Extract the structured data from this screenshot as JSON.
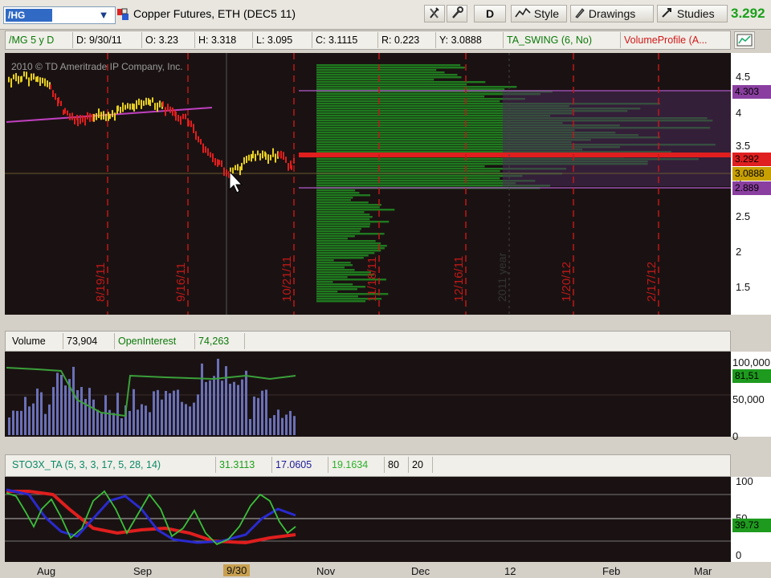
{
  "toolbar": {
    "symbol": "/HG",
    "title": "Copper Futures, ETH (DEC5 11)",
    "period_label": "D",
    "style_label": "Style",
    "drawings_label": "Drawings",
    "studies_label": "Studies",
    "last_price": "3.292"
  },
  "info_bar": {
    "symbol_period": "/MG 5 y D",
    "date": "D: 9/30/11",
    "open": "O: 3.23",
    "high": "H: 3.318",
    "low": "L: 3.095",
    "close": "C: 3.1115",
    "range": "R: 0.223",
    "y": "Y: 3.0888",
    "study1": "TA_SWING (6, No)",
    "study2": "VolumeProfile (A..."
  },
  "price_panel": {
    "copyright": "2010 © TD Ameritrade IP Company, Inc.",
    "axis_ticks": [
      "4.5",
      "4",
      "3.5",
      "3",
      "2.5",
      "2",
      "1.5"
    ],
    "badges": [
      {
        "text": "4.303",
        "color": "#8a3fa0"
      },
      {
        "text": "3.292",
        "color": "#e02020"
      },
      {
        "text": "3.0888",
        "color": "#c8a000"
      },
      {
        "text": "2.889",
        "color": "#8a3fa0"
      }
    ],
    "date_labels": [
      "8/19/11",
      "9/16/11",
      "10/21/11",
      "11/18/11",
      "12/16/11",
      "1/20/12",
      "2/17/12"
    ],
    "year_label": "2011 year"
  },
  "volume_panel": {
    "label": "Volume",
    "volume_value": "73,904",
    "oi_label": "OpenInterest",
    "oi_value": "74,263",
    "axis_ticks": [
      "100,000",
      "50,000",
      "0"
    ],
    "badge": "81,51"
  },
  "sto_panel": {
    "label": "STO3X_TA (5, 3, 3, 17, 5, 28, 14)",
    "v1": "31.3113",
    "v2": "17.0605",
    "v3": "19.1634",
    "v4": "80",
    "v5": "20",
    "axis_ticks": [
      "100",
      "50",
      "0"
    ],
    "badge": "39.73"
  },
  "x_axis": {
    "labels": [
      "Aug",
      "Sep",
      "9/30",
      "Nov",
      "Dec",
      "12",
      "Feb",
      "Mar"
    ]
  },
  "colors": {
    "panel_bg": "#1a1212",
    "down": "#e01e1e",
    "up": "#e8d020",
    "profile": "#1e7a1e",
    "purple": "#8a3fa0"
  }
}
